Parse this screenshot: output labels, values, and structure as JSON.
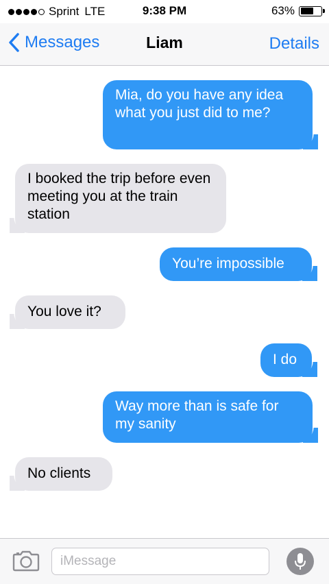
{
  "status_bar": {
    "carrier": "Sprint",
    "network": "LTE",
    "time": "9:38 PM",
    "battery": "63%",
    "battery_level": 0.63,
    "signal_bars": 4
  },
  "nav": {
    "back_label": "Messages",
    "title": "Liam",
    "details_label": "Details"
  },
  "messages": [
    {
      "direction": "outgoing",
      "text": "Mia, do you have any idea what you just did to me?"
    },
    {
      "direction": "incoming",
      "text": "I booked the trip before even meeting you at the train station"
    },
    {
      "direction": "outgoing",
      "text": "You’re impossible"
    },
    {
      "direction": "incoming",
      "text": "You love it?"
    },
    {
      "direction": "outgoing",
      "text": "I do"
    },
    {
      "direction": "outgoing",
      "text": "Way more than is safe for my sanity"
    },
    {
      "direction": "incoming",
      "text": "No clients"
    }
  ],
  "input": {
    "placeholder": "iMessage",
    "value": ""
  },
  "colors": {
    "accent": "#1e7cf2",
    "outgoing_bubble": "#3198f6",
    "incoming_bubble": "#e6e5ea"
  },
  "icons": {
    "back": "chevron-left-icon",
    "camera": "camera-icon",
    "mic": "microphone-icon"
  }
}
